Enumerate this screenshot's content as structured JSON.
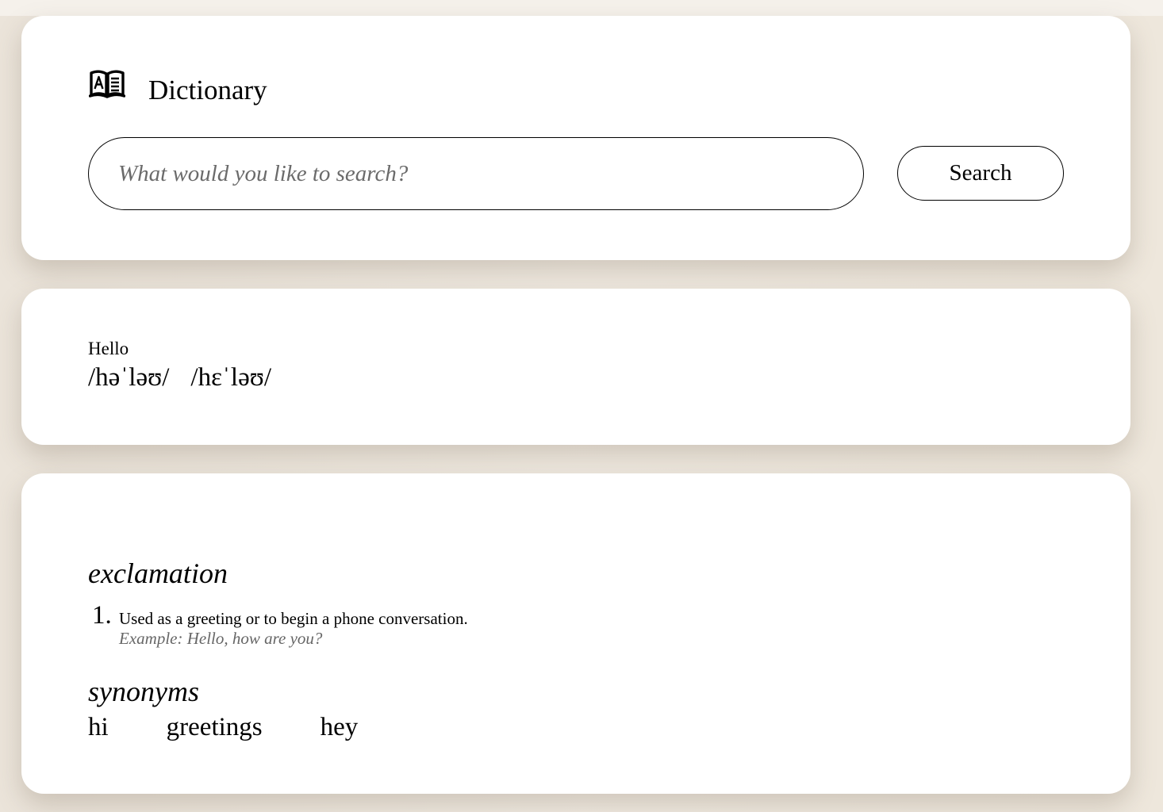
{
  "header": {
    "app_title": "Dictionary",
    "icon": "open-book-icon"
  },
  "search": {
    "placeholder": "What would you like to search?",
    "value": "",
    "button_label": "Search"
  },
  "word": {
    "text": "Hello",
    "phonetics": [
      "/həˈləʊ/",
      "/hɛˈləʊ/"
    ]
  },
  "meanings": [
    {
      "part_of_speech": "exclamation",
      "definitions": [
        {
          "number": "1.",
          "text": "Used as a greeting or to begin a phone conversation.",
          "example": "Example: Hello, how are you?"
        }
      ],
      "synonyms_heading": "synonyms",
      "synonyms": [
        "hi",
        "greetings",
        "hey"
      ]
    }
  ]
}
